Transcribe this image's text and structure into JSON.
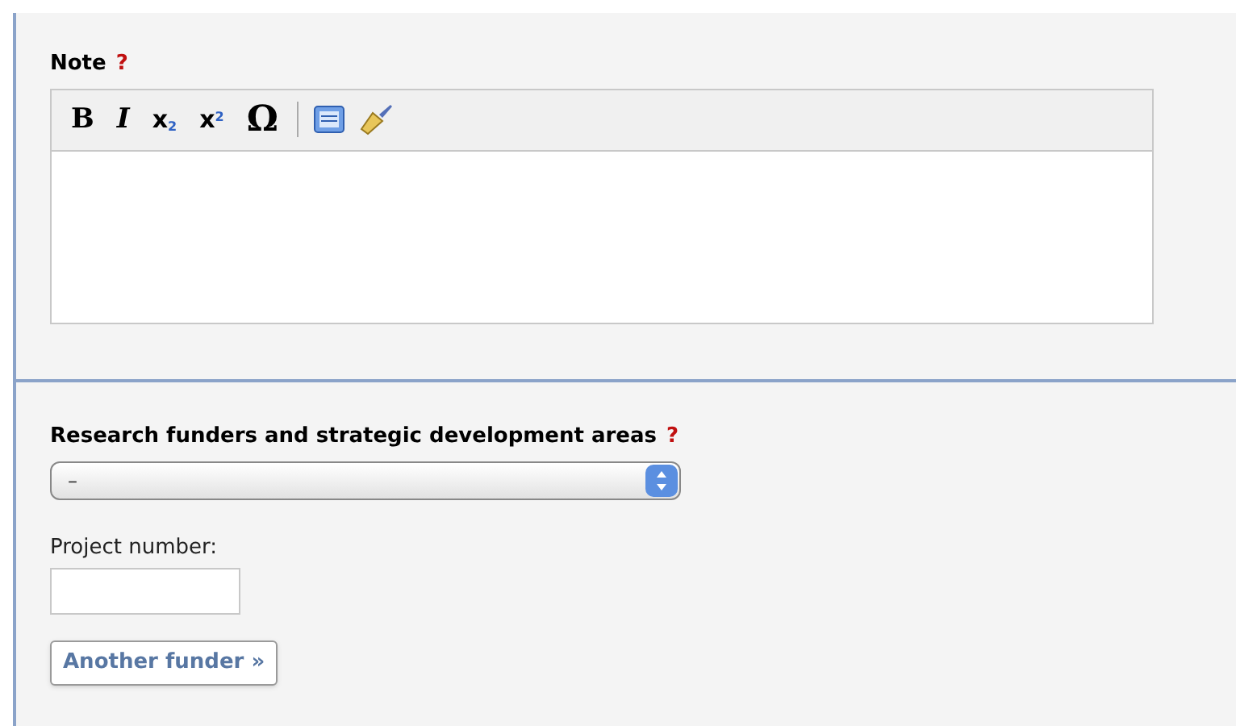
{
  "note": {
    "label": "Note",
    "help": "?",
    "toolbar": [
      {
        "kind": "bold",
        "label": "B"
      },
      {
        "kind": "italic",
        "label": "I"
      },
      {
        "kind": "script",
        "label": "x$_{2}$"
      },
      {
        "kind": "script",
        "label": "x$^{2}$"
      },
      {
        "kind": "symbol",
        "label": "Ω"
      },
      {
        "kind": "separator"
      },
      {
        "kind": "list"
      },
      {
        "kind": "brush"
      }
    ]
  },
  "funders": {
    "label": "Research funders and strategic development areas",
    "help": "?",
    "select_value": "–",
    "project_label": "Project number:",
    "button": "Another funder »"
  }
}
